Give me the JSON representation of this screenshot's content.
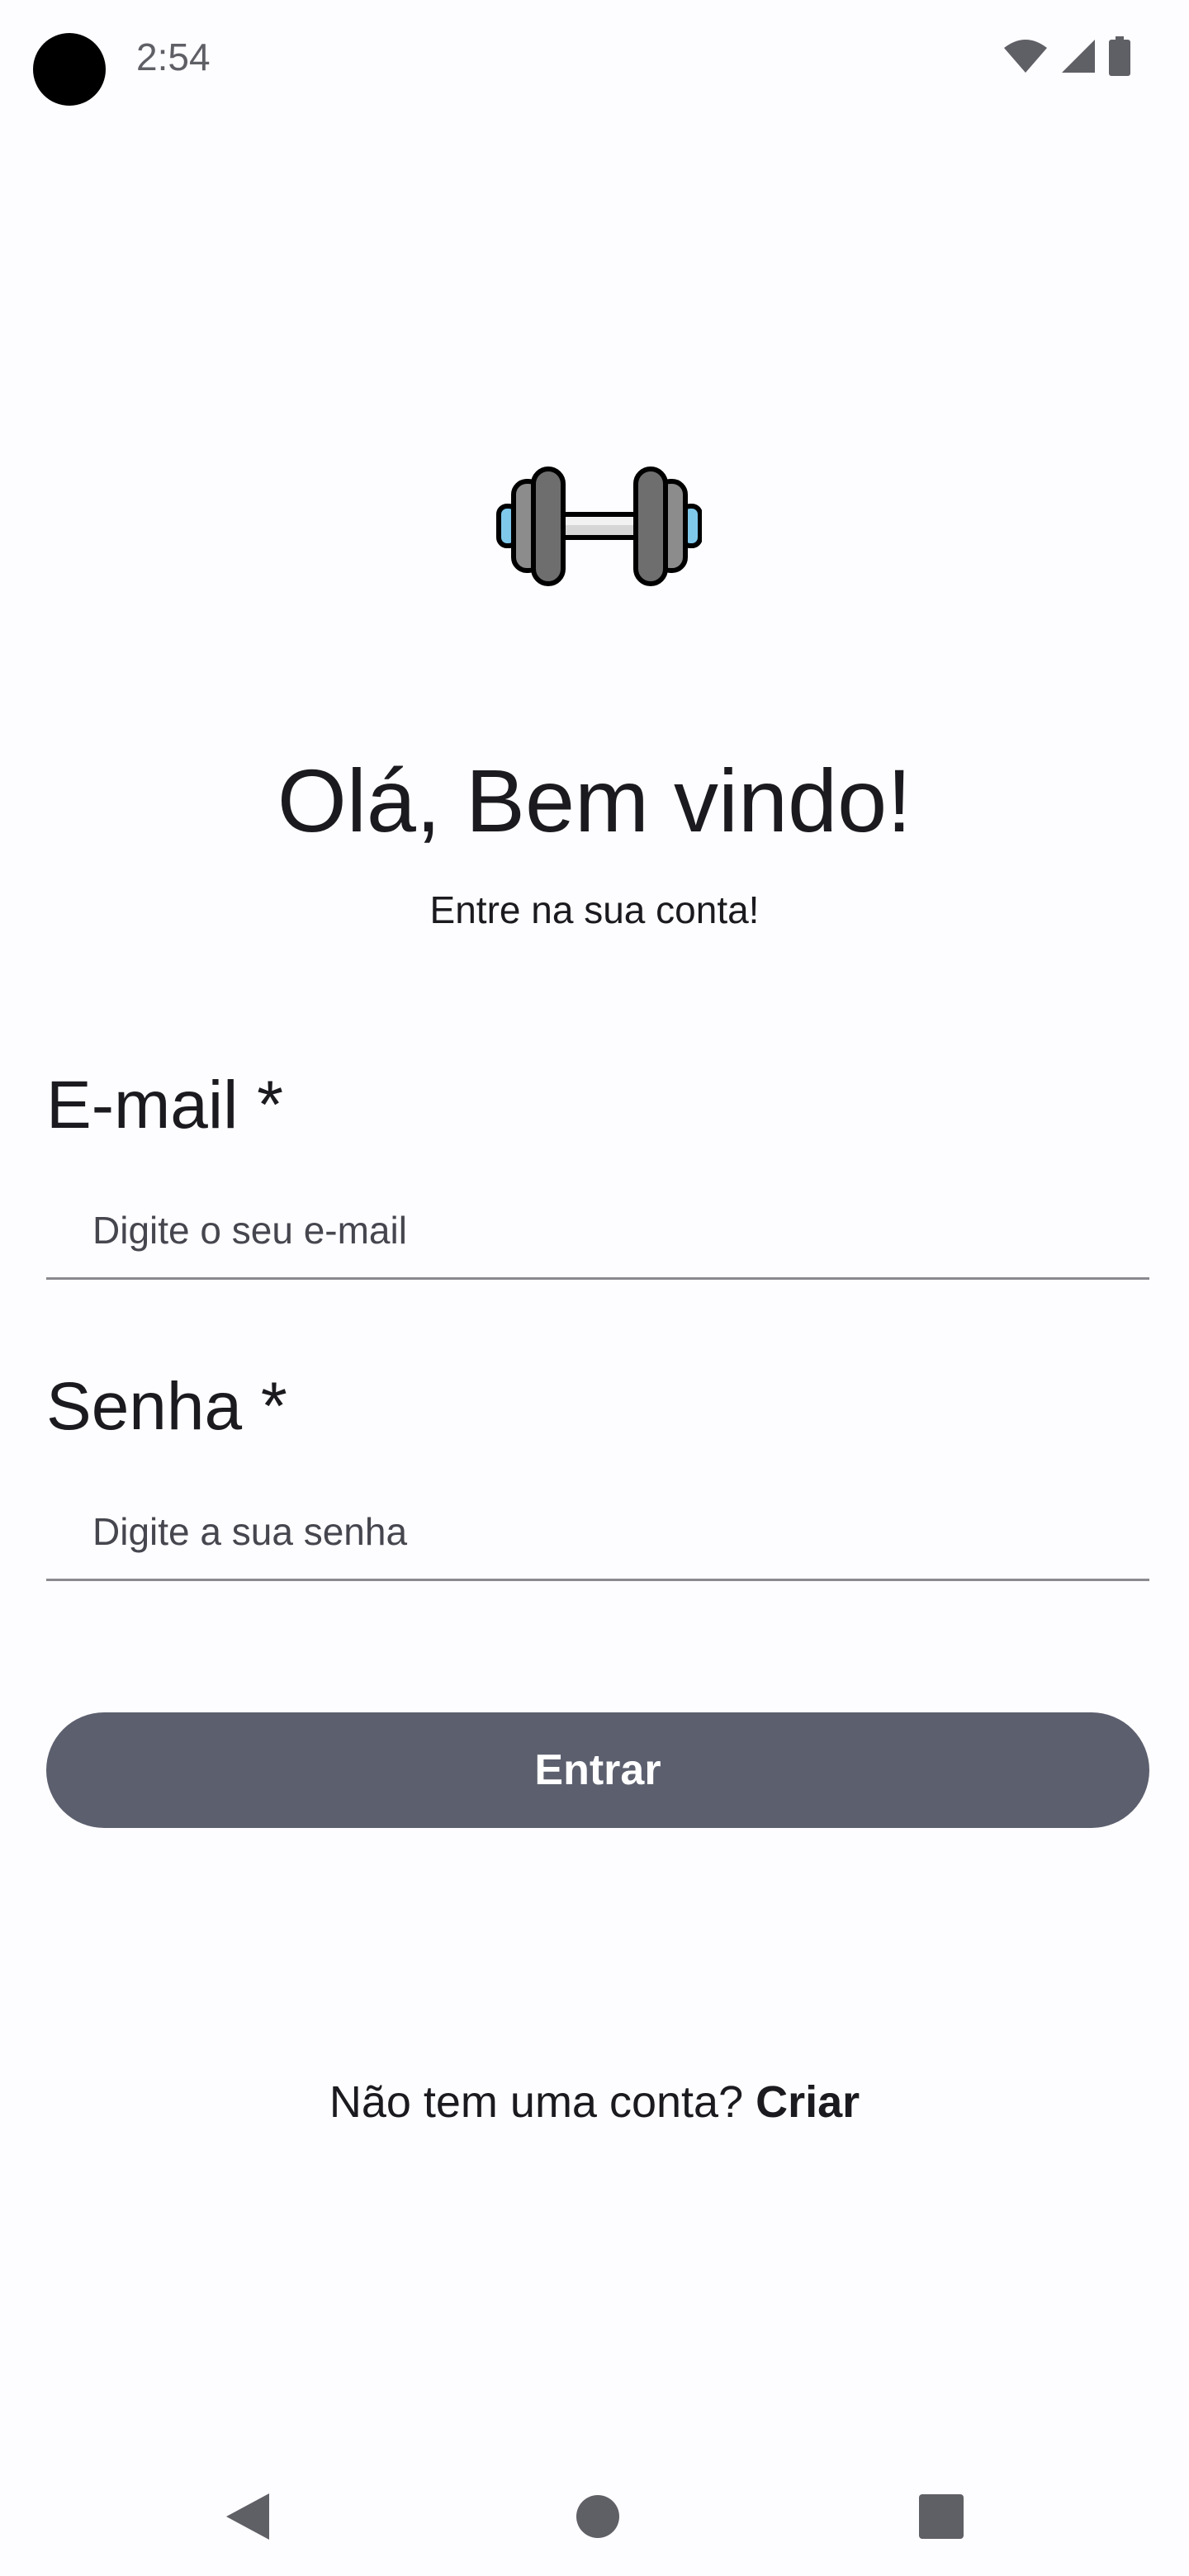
{
  "status_bar": {
    "time": "2:54",
    "icons": [
      "wifi-icon",
      "cellular-signal-icon",
      "battery-icon"
    ]
  },
  "logo": {
    "icon": "dumbbell-icon"
  },
  "header": {
    "title": "Olá, Bem vindo!",
    "subtitle": "Entre na sua conta!"
  },
  "form": {
    "email": {
      "label": "E-mail *",
      "value": "",
      "placeholder": "Digite o seu e-mail"
    },
    "password": {
      "label": "Senha *",
      "value": "",
      "placeholder": "Digite a sua senha"
    },
    "submit_label": "Entrar"
  },
  "signup": {
    "prompt": "Não tem uma conta? ",
    "link_label": "Criar"
  },
  "navigation": {
    "items": [
      "back-icon",
      "home-icon",
      "recents-icon"
    ]
  },
  "colors": {
    "background": "#fdfcff",
    "button": "#5c5f6e",
    "button_text": "#ffffff",
    "text": "#1b1b1f",
    "divider": "#8a8a90"
  }
}
